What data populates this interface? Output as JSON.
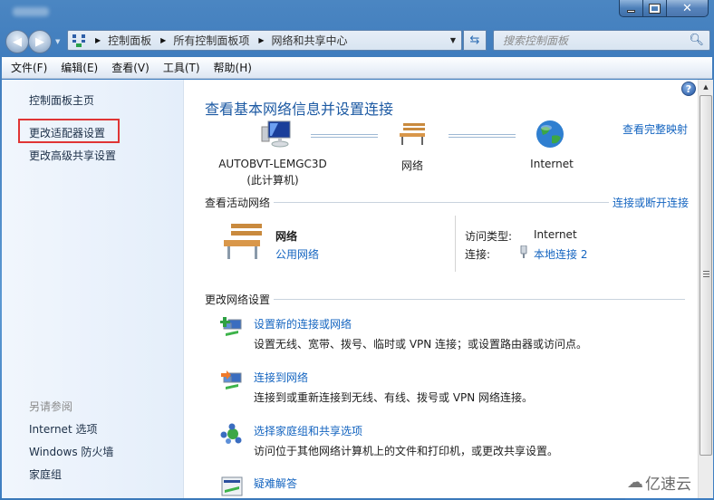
{
  "window": {
    "caption_buttons": {
      "minimize": "minimize",
      "maximize": "maximize",
      "close": "✕"
    }
  },
  "nav": {
    "back_icon": "back-arrow-icon",
    "forward_icon": "forward-arrow-icon",
    "breadcrumb": [
      "控制面板",
      "所有控制面板项",
      "网络和共享中心"
    ],
    "search_placeholder": "搜索控制面板"
  },
  "menu": [
    "文件(F)",
    "编辑(E)",
    "查看(V)",
    "工具(T)",
    "帮助(H)"
  ],
  "sidebar": {
    "home": "控制面板主页",
    "links": [
      "更改适配器设置",
      "更改高级共享设置"
    ],
    "see_also_label": "另请参阅",
    "see_also": [
      "Internet 选项",
      "Windows 防火墙",
      "家庭组"
    ]
  },
  "main": {
    "title": "查看基本网络信息并设置连接",
    "full_map_link": "查看完整映射",
    "map": {
      "computer_name": "AUTOBVT-LEMGC3D",
      "computer_sub": "(此计算机)",
      "network_name": "网络",
      "internet_name": "Internet"
    },
    "active_networks": {
      "heading": "查看活动网络",
      "action_link": "连接或断开连接",
      "network_name": "网络",
      "network_type": "公用网络",
      "access_type_label": "访问类型:",
      "access_type_value": "Internet",
      "connections_label": "连接:",
      "connection_value": "本地连接 2"
    },
    "change_settings": {
      "heading": "更改网络设置",
      "tasks": [
        {
          "title": "设置新的连接或网络",
          "desc": "设置无线、宽带、拨号、临时或 VPN 连接；或设置路由器或访问点。"
        },
        {
          "title": "连接到网络",
          "desc": "连接到或重新连接到无线、有线、拨号或 VPN 网络连接。"
        },
        {
          "title": "选择家庭组和共享选项",
          "desc": "访问位于其他网络计算机上的文件和打印机，或更改共享设置。"
        },
        {
          "title": "疑难解答",
          "desc": ""
        }
      ]
    }
  },
  "watermark": "亿速云",
  "colors": {
    "link": "#1565c0",
    "title": "#1d5aa3",
    "highlight_box": "#e03535"
  }
}
